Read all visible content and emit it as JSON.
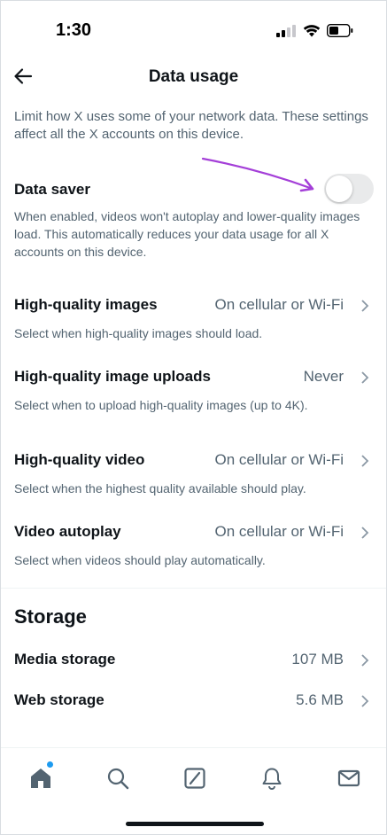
{
  "status_bar": {
    "time": "1:30"
  },
  "header": {
    "title": "Data usage"
  },
  "intro": "Limit how X uses some of your network data. These settings affect all the X accounts on this device.",
  "data_saver": {
    "title": "Data saver",
    "enabled": false,
    "description": "When enabled, videos won't autoplay and lower-quality images load. This automatically reduces your data usage for all X accounts on this device."
  },
  "settings": [
    {
      "title": "High-quality images",
      "value": "On cellular or Wi-Fi",
      "description": "Select when high-quality images should load."
    },
    {
      "title": "High-quality image uploads",
      "value": "Never",
      "description": "Select when to upload high-quality images (up to 4K)."
    },
    {
      "title": "High-quality video",
      "value": "On cellular or Wi-Fi",
      "description": "Select when the highest quality available should play."
    },
    {
      "title": "Video autoplay",
      "value": "On cellular or Wi-Fi",
      "description": "Select when videos should play automatically."
    }
  ],
  "storage": {
    "section_title": "Storage",
    "items": [
      {
        "title": "Media storage",
        "value": "107 MB"
      },
      {
        "title": "Web storage",
        "value": "5.6 MB"
      }
    ]
  },
  "bottom_nav": {
    "items": [
      "home-icon",
      "search-icon",
      "grok-icon",
      "notifications-icon",
      "messages-icon"
    ],
    "has_notification_dot": true
  },
  "colors": {
    "accent": "#1d9bf0",
    "annotation_arrow": "#a43fd8",
    "secondary_text": "#536471",
    "primary_text": "#0f1419"
  }
}
